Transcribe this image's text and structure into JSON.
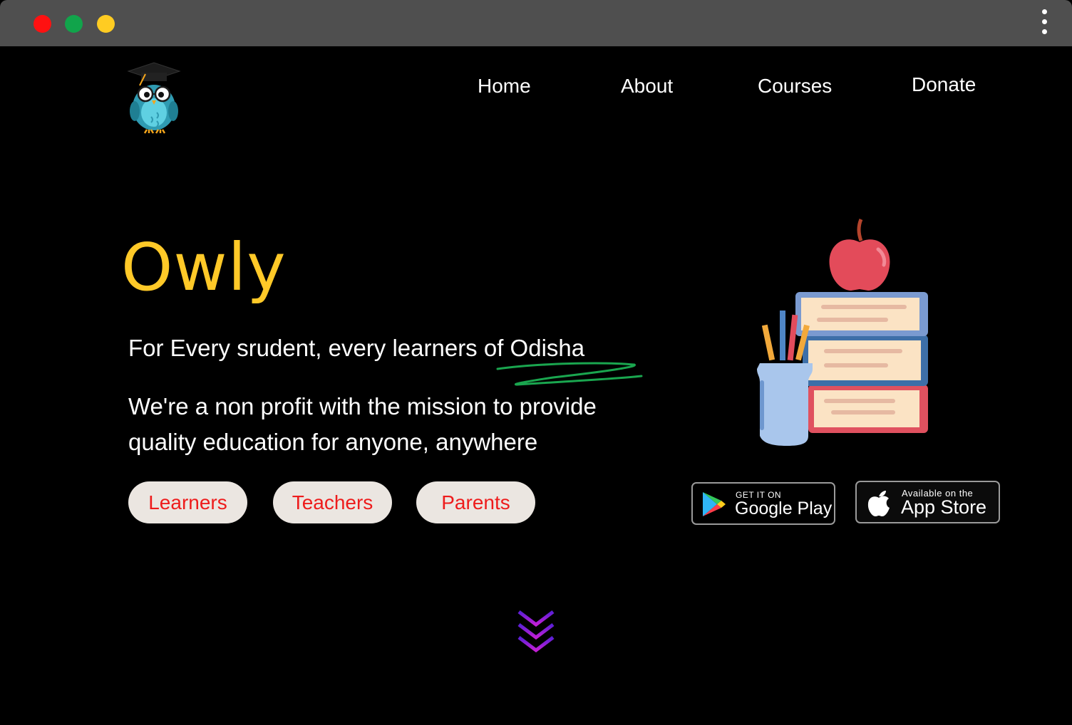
{
  "window": {
    "controls": [
      "close",
      "maximize",
      "minimize"
    ],
    "menu_icon": "kebab-menu-icon"
  },
  "brand": {
    "logo_icon": "owl-graduate-logo"
  },
  "nav": {
    "home": "Home",
    "about": "About",
    "courses": "Courses",
    "donate": "Donate"
  },
  "hero": {
    "title": "Owly",
    "tagline": "For Every srudent, every learners of Odisha",
    "mission_line1": "We're a non profit with the mission to provide",
    "mission_line2": "quality education for anyone, anywhere"
  },
  "audience_buttons": {
    "learners": "Learners",
    "teachers": "Teachers",
    "parents": "Parents"
  },
  "stores": {
    "google_small": "GET IT ON",
    "google_big": "Google Play",
    "apple_small": "Available on the",
    "apple_big": "App Store"
  },
  "illustration": "books-apple-pencils",
  "scroll_icon": "triple-chevron-down-icon",
  "colors": {
    "accent_yellow": "#ffc928",
    "button_text_red": "#ee1c1c",
    "button_bg": "#ebe6e1",
    "scribble_green": "#1aa64f"
  }
}
